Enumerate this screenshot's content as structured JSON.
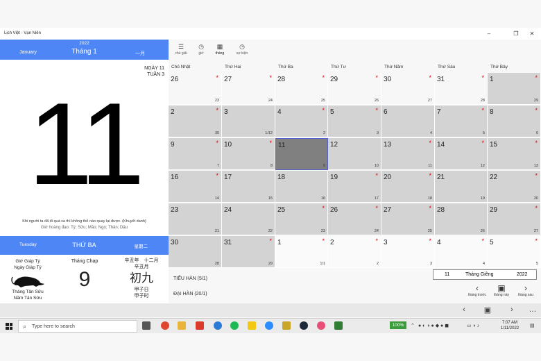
{
  "window": {
    "title": "Lịch Việt - Vạn Niên",
    "minimize": "–",
    "maximize": "❐",
    "close": "✕"
  },
  "left": {
    "year": "2022",
    "month": "Tháng 1",
    "month_en": "January",
    "month_cn": "一月",
    "day_label": "NGÀY 11",
    "week_label": "TUẦN 3",
    "big_day": "11",
    "quote": "Khi người ta đã đi quá xa thì không thể nào quay lại được. (Khuyết danh)",
    "good_hours": "Giờ hoàng đạo: Tý; Sửu; Mão; Ngọ; Thân; Dậu",
    "weekday_en": "Tuesday",
    "weekday_vi": "THỨ BA",
    "weekday_cn": "星期二",
    "can_chi_hour": "Giờ Giáp Tý",
    "can_chi_day": "Ngày Giáp Tý",
    "can_chi_month": "Tháng Tân Sửu",
    "can_chi_year": "Năm Tân Sửu",
    "lunar_month": "Tháng Chạp",
    "lunar_day": "9",
    "cn_year_month": "辛丑年　十二月",
    "cn_month": "辛丑月",
    "cn_day_big": "初九",
    "cn_day": "甲子日",
    "cn_hour": "甲子时"
  },
  "toolbar": [
    {
      "label": "chú giải",
      "icon": "☰"
    },
    {
      "label": "giờ",
      "icon": "◷"
    },
    {
      "label": "tháng",
      "icon": "▦"
    },
    {
      "label": "sự kiện",
      "icon": "◷"
    }
  ],
  "calendar": {
    "headers": [
      "Chủ Nhật",
      "Thứ Hai",
      "Thứ Ba",
      "Thứ Tư",
      "Thứ Năm",
      "Thứ Sáu",
      "Thứ Bảy"
    ],
    "rows": [
      [
        {
          "d": "26",
          "l": "23",
          "star": true,
          "t": "light"
        },
        {
          "d": "27",
          "l": "24",
          "star": true,
          "t": "light"
        },
        {
          "d": "28",
          "l": "25",
          "star": true,
          "t": "light"
        },
        {
          "d": "29",
          "l": "26",
          "star": true,
          "t": "light"
        },
        {
          "d": "30",
          "l": "27",
          "star": true,
          "t": "light"
        },
        {
          "d": "31",
          "l": "28",
          "star": true,
          "t": "light"
        },
        {
          "d": "1",
          "l": "29",
          "star": true,
          "t": "gray"
        }
      ],
      [
        {
          "d": "2",
          "l": "30",
          "star": true,
          "t": "gray"
        },
        {
          "d": "3",
          "l": "1/12",
          "star": false,
          "t": "gray"
        },
        {
          "d": "4",
          "l": "2",
          "star": true,
          "t": "gray"
        },
        {
          "d": "5",
          "l": "3",
          "star": true,
          "t": "gray"
        },
        {
          "d": "6",
          "l": "4",
          "star": false,
          "t": "gray"
        },
        {
          "d": "7",
          "l": "5",
          "star": true,
          "t": "gray"
        },
        {
          "d": "8",
          "l": "6",
          "star": true,
          "t": "gray"
        }
      ],
      [
        {
          "d": "9",
          "l": "7",
          "star": true,
          "t": "gray"
        },
        {
          "d": "10",
          "l": "8",
          "star": true,
          "t": "gray"
        },
        {
          "d": "11",
          "l": "9",
          "star": false,
          "t": "sel"
        },
        {
          "d": "12",
          "l": "10",
          "star": false,
          "t": "gray"
        },
        {
          "d": "13",
          "l": "11",
          "star": true,
          "t": "gray"
        },
        {
          "d": "14",
          "l": "12",
          "star": true,
          "t": "gray"
        },
        {
          "d": "15",
          "l": "13",
          "star": true,
          "t": "gray"
        }
      ],
      [
        {
          "d": "16",
          "l": "14",
          "star": true,
          "t": "gray"
        },
        {
          "d": "17",
          "l": "15",
          "star": false,
          "t": "gray"
        },
        {
          "d": "18",
          "l": "16",
          "star": false,
          "t": "gray"
        },
        {
          "d": "19",
          "l": "17",
          "star": true,
          "t": "gray"
        },
        {
          "d": "20",
          "l": "18",
          "star": true,
          "t": "gray"
        },
        {
          "d": "21",
          "l": "19",
          "star": false,
          "t": "gray"
        },
        {
          "d": "22",
          "l": "20",
          "star": true,
          "t": "gray"
        }
      ],
      [
        {
          "d": "23",
          "l": "21",
          "star": false,
          "t": "gray"
        },
        {
          "d": "24",
          "l": "22",
          "star": false,
          "t": "gray"
        },
        {
          "d": "25",
          "l": "23",
          "star": true,
          "t": "gray"
        },
        {
          "d": "26",
          "l": "24",
          "star": true,
          "t": "gray"
        },
        {
          "d": "27",
          "l": "25",
          "star": true,
          "t": "gray"
        },
        {
          "d": "28",
          "l": "26",
          "star": false,
          "t": "gray"
        },
        {
          "d": "29",
          "l": "27",
          "star": true,
          "t": "gray"
        }
      ],
      [
        {
          "d": "30",
          "l": "28",
          "star": false,
          "t": "gray"
        },
        {
          "d": "31",
          "l": "29",
          "star": true,
          "t": "gray"
        },
        {
          "d": "1",
          "l": "1/1",
          "star": true,
          "t": "white"
        },
        {
          "d": "2",
          "l": "2",
          "star": true,
          "t": "white"
        },
        {
          "d": "3",
          "l": "3",
          "star": true,
          "t": "white"
        },
        {
          "d": "4",
          "l": "4",
          "star": true,
          "t": "white"
        },
        {
          "d": "5",
          "l": "5",
          "star": true,
          "t": "white"
        }
      ]
    ]
  },
  "solar_terms": [
    "TIỂU HÀN (5/1)",
    "ĐẠI HÀN (20/1)"
  ],
  "lunar_date": {
    "day": "11",
    "month": "Tháng Giêng",
    "year": "2022"
  },
  "nav": [
    {
      "label": "tháng trước",
      "icon": "‹"
    },
    {
      "label": "tháng này",
      "icon": "▣"
    },
    {
      "label": "tháng sau",
      "icon": "›"
    }
  ],
  "bottombar": [
    "‹",
    "▣",
    "›",
    "…"
  ],
  "taskbar": {
    "search_placeholder": "Type here to search",
    "battery": "100%",
    "time": "7:07 AM",
    "date": "1/11/2022"
  }
}
